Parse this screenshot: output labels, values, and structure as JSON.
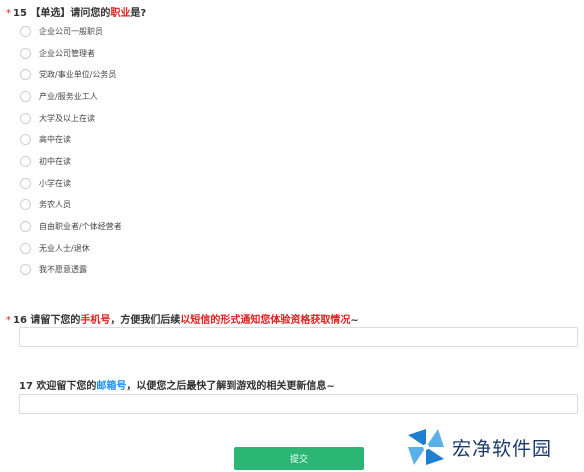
{
  "q15": {
    "required_mark": "*",
    "title_prefix": "15 【单选】请问您的",
    "title_highlight": "职业",
    "title_suffix": "是?",
    "options": [
      "企业公司一般职员",
      "企业公司管理者",
      "党政/事业单位/公务员",
      "产业/服务业工人",
      "大学及以上在读",
      "高中在读",
      "初中在读",
      "小学在读",
      "务农人员",
      "自由职业者/个体经营者",
      "无业人士/退休",
      "我不愿意透露"
    ]
  },
  "q16": {
    "required_mark": "*",
    "title_prefix": "16 请留下您的",
    "title_highlight1": "手机号",
    "title_middle": "，方便我们后续",
    "title_highlight2": "以短信的形式通知您体验资格获取情况",
    "title_suffix": "~",
    "input_value": ""
  },
  "q17": {
    "title_prefix": "17 欢迎留下您的",
    "title_highlight": "邮箱号",
    "title_suffix": "，以便您之后最快了解到游戏的相关更新信息~",
    "input_value": ""
  },
  "submit_label": "提交",
  "watermark": {
    "text": "宏净软件园",
    "logo_icon": "pinwheel-logo-icon"
  },
  "colors": {
    "required": "#e02020",
    "highlight_red": "#e02020",
    "highlight_blue": "#1e90ff",
    "submit_bg": "#2bb673",
    "watermark_text": "#1b3a6b"
  }
}
